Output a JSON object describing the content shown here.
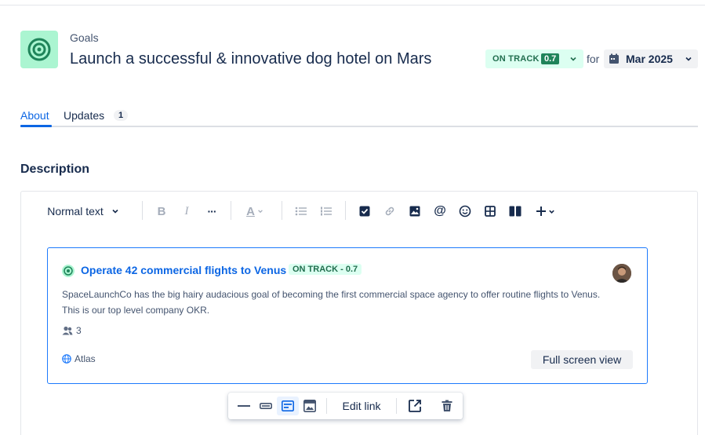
{
  "header": {
    "breadcrumb": "Goals",
    "title": "Launch a successful & innovative dog hotel on Mars",
    "status_label": "ON TRACK",
    "status_score": "0.7",
    "for_label": "for",
    "target_date": "Mar 2025",
    "icon": "goal-target-icon"
  },
  "tabs": [
    {
      "label": "About",
      "active": true
    },
    {
      "label": "Updates",
      "count": "1",
      "active": false
    }
  ],
  "description": {
    "label": "Description",
    "toolbar": {
      "text_style": "Normal text",
      "icons": [
        "bold-icon",
        "italic-icon",
        "more-formatting-icon",
        "text-color-icon",
        "bullet-list-icon",
        "numbered-list-icon",
        "task-checkbox-icon",
        "link-icon",
        "image-icon",
        "mention-icon",
        "emoji-icon",
        "table-icon",
        "layout-columns-icon",
        "insert-more-icon"
      ]
    }
  },
  "card": {
    "title": "Operate 42 commercial flights to Venus",
    "status": "ON TRACK - 0.7",
    "description": "SpaceLaunchCo has the big hairy audacious goal of becoming the first commercial space agency to offer routine flights to Venus. This is our top level company OKR.",
    "members_count": "3",
    "source": "Atlas",
    "fullscreen_label": "Full screen view"
  },
  "link_toolbar": {
    "edit_link_label": "Edit link",
    "icons": [
      "inline-view-icon",
      "block-view-icon",
      "card-view-icon",
      "embed-view-icon",
      "open-link-icon",
      "delete-icon"
    ]
  },
  "colors": {
    "accent": "#0c66e4",
    "status_green": "#216e4e",
    "status_bg": "#dcfff1",
    "goal_icon_bg": "#abf5d1"
  }
}
